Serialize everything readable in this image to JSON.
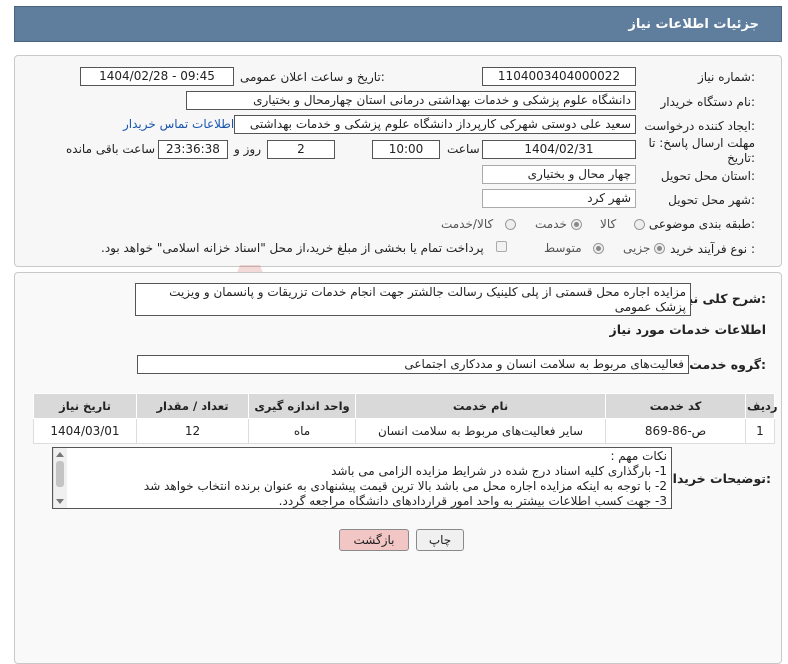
{
  "header": {
    "title": "جزئیات اطلاعات نیاز"
  },
  "form": {
    "need_number_label": "شماره نیاز:",
    "need_number": "1104003404000022",
    "announce_label": "تاریخ و ساعت اعلان عمومی:",
    "announce_value": "1404/02/28 - 09:45",
    "buyer_org_label": "نام دستگاه خریدار:",
    "buyer_org": "دانشگاه علوم پزشکی و خدمات بهداشتی درمانی استان چهارمحال و بختیاری",
    "creator_label": "ایجاد کننده درخواست:",
    "creator": "سعید علی دوستی شهرکی کارپرداز دانشگاه علوم پزشکی و خدمات بهداشتی",
    "contact_link": "اطلاعات تماس خریدار",
    "deadline_label_1": "مهلت ارسال پاسخ: تا",
    "deadline_label_2": "تاریخ:",
    "deadline_date": "1404/02/31",
    "time_label": "ساعت",
    "deadline_time": "10:00",
    "days_value": "2",
    "days_label": "روز و",
    "remaining_time": "23:36:38",
    "remaining_label": "ساعت باقی مانده",
    "province_label": "استان محل تحویل:",
    "province": "چهار محال و بختیاری",
    "city_label": "شهر محل تحویل:",
    "city": "شهر کرد",
    "category_label": "طبقه بندی موضوعی:",
    "category_options": [
      "کالا",
      "خدمت",
      "کالا/خدمت"
    ],
    "category_selected": "خدمت",
    "process_label": "نوع فرآیند خرید :",
    "process_options": [
      "جزیی",
      "متوسط"
    ],
    "process_selected": "جزیی",
    "payment_note": "پرداخت تمام یا بخشی از مبلغ خرید،از محل \"اسناد خزانه اسلامی\" خواهد بود."
  },
  "description": {
    "label": "شرح کلی نیاز:",
    "text": "مزایده اجاره محل قسمتی از  پلی کلینیک رسالت جالشتر جهت انجام خدمات تزریقات و پانسمان و ویزیت پزشک عمومی"
  },
  "services": {
    "section_title": "اطلاعات خدمات مورد نیاز",
    "group_label": "گروه خدمت:",
    "group_value": "فعالیت‌های مربوط به سلامت انسان و مددکاری اجتماعی",
    "columns": [
      "ردیف",
      "کد خدمت",
      "نام خدمت",
      "واحد اندازه گیری",
      "تعداد / مقدار",
      "تاریخ نیاز"
    ],
    "rows": [
      {
        "row": "1",
        "code": "ص-86-869",
        "name": "سایر فعالیت‌های مربوط به سلامت انسان",
        "unit": "ماه",
        "qty": "12",
        "date": "1404/03/01"
      }
    ]
  },
  "notes": {
    "label": "توضیحات خریدار:",
    "lines": [
      "نکات مهم :",
      "1- بارگذاری کلیه اسناد درج شده در شرایط مزایده الزامی می باشد",
      "2- با توجه به اینکه مزایده اجاره محل می باشد بالا ترین قیمت پیشنهادی به عنوان برنده انتخاب خواهد شد",
      "3- جهت کسب اطلاعات بیشتر به واحد امور قراردادهای دانشگاه مراجعه گردد."
    ]
  },
  "buttons": {
    "print": "چاپ",
    "back": "بازگشت"
  },
  "colors": {
    "header_bg": "#5f7d9c",
    "back_btn_bg": "#f3c6c6",
    "watermark": "#c0392b"
  }
}
